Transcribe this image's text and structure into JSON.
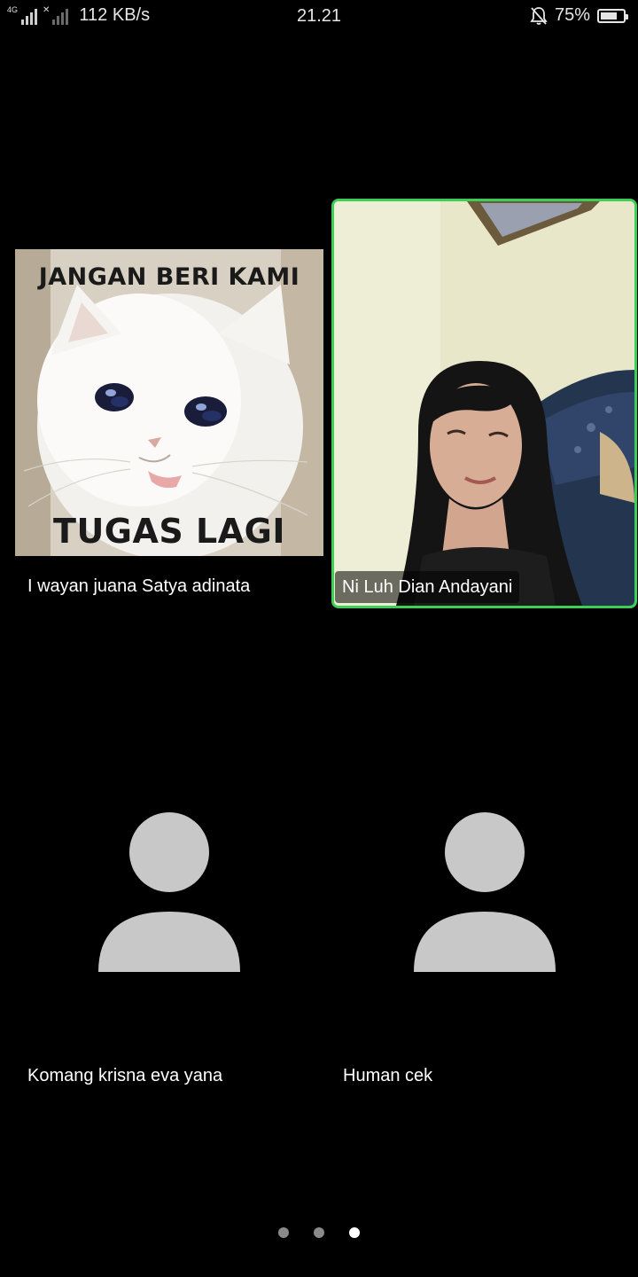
{
  "status_bar": {
    "network_type": "4G",
    "data_speed": "112 KB/s",
    "time": "21.21",
    "battery_percent": "75%",
    "battery_level": 0.75,
    "icons": [
      "signal-icon",
      "no-signal-icon",
      "bell-off-icon",
      "battery-icon"
    ]
  },
  "participants": [
    {
      "name": "I wayan juana Satya adinata",
      "media": "image",
      "meme_top_text": "JANGAN BERI KAMI",
      "meme_bottom_text": "TUGAS LAGI"
    },
    {
      "name": "Ni Luh Dian Andayani",
      "media": "video",
      "active_speaker": true
    },
    {
      "name": "Komang krisna eva yana",
      "media": "avatar-placeholder"
    },
    {
      "name": "Human cek",
      "media": "avatar-placeholder"
    }
  ],
  "pager": {
    "page_count": 3,
    "current_page": 3
  },
  "colors": {
    "background": "#000000",
    "active_speaker_border": "#3ccf55",
    "avatar_placeholder": "#c8c8c8",
    "dot_inactive": "#8a8a8a",
    "dot_active": "#ffffff"
  }
}
